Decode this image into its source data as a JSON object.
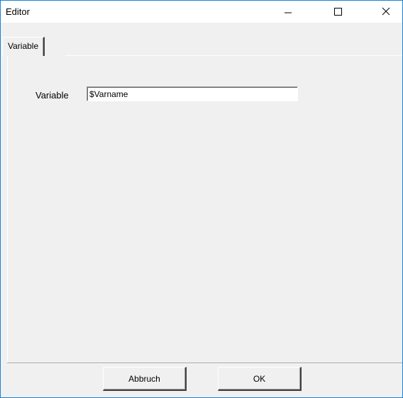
{
  "window": {
    "title": "Editor"
  },
  "caption": {
    "minimize_icon": "minimize-icon",
    "maximize_icon": "maximize-icon",
    "close_icon": "close-icon"
  },
  "tabs": [
    {
      "label": "Variable",
      "selected": true
    }
  ],
  "form": {
    "variable_label": "Variable",
    "variable_value": "$Varname"
  },
  "buttons": {
    "cancel_label": "Abbruch",
    "ok_label": "OK"
  },
  "colors": {
    "window_border": "#1883d7",
    "face": "#f0f0f0"
  }
}
